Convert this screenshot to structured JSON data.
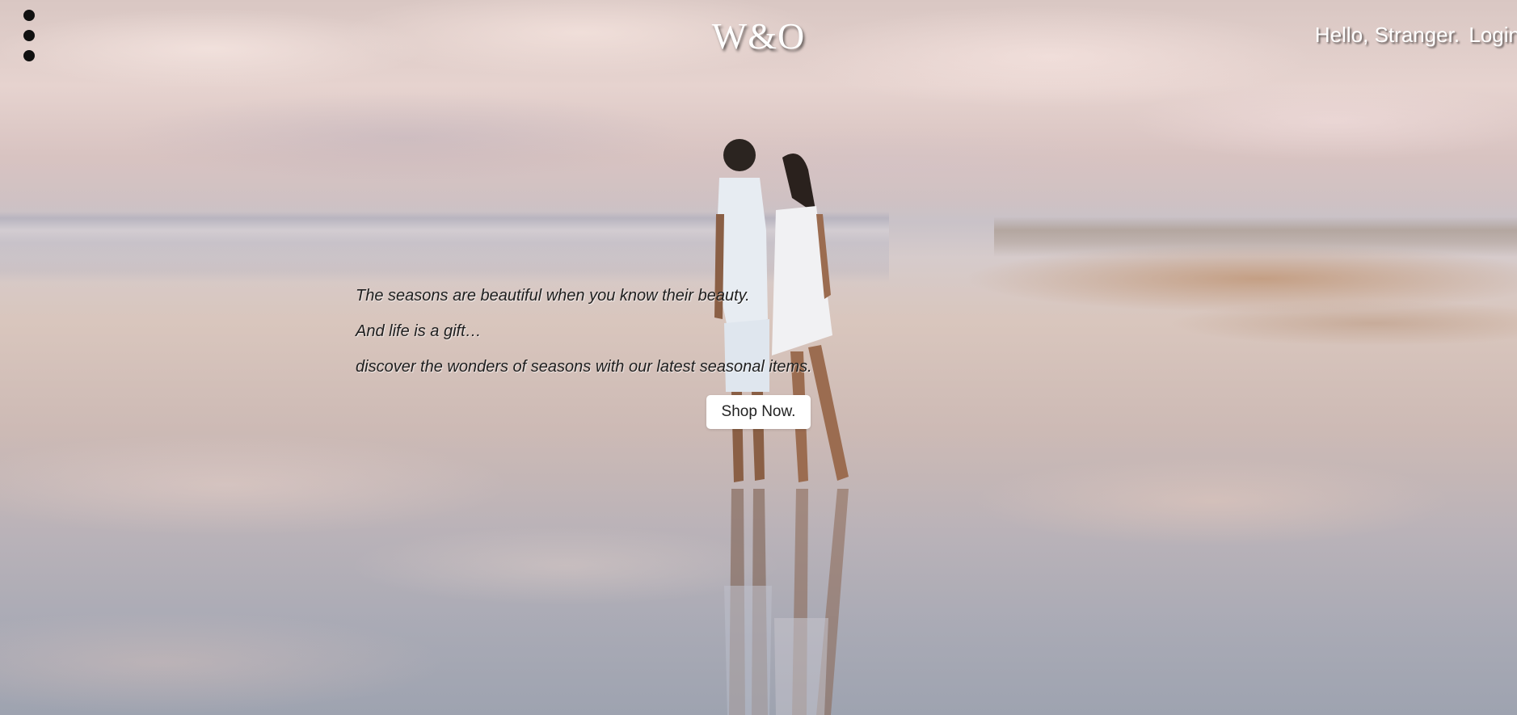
{
  "header": {
    "menu_icon": "vertical-dots-icon",
    "brand": "W&O",
    "greeting": "Hello, Stranger.",
    "login_label": "Login"
  },
  "hero": {
    "lines": [
      "The seasons are beautiful when you know their beauty.",
      "And life is a gift…",
      "discover the wonders of seasons with our latest seasonal items."
    ],
    "cta_label": "Shop Now."
  }
}
